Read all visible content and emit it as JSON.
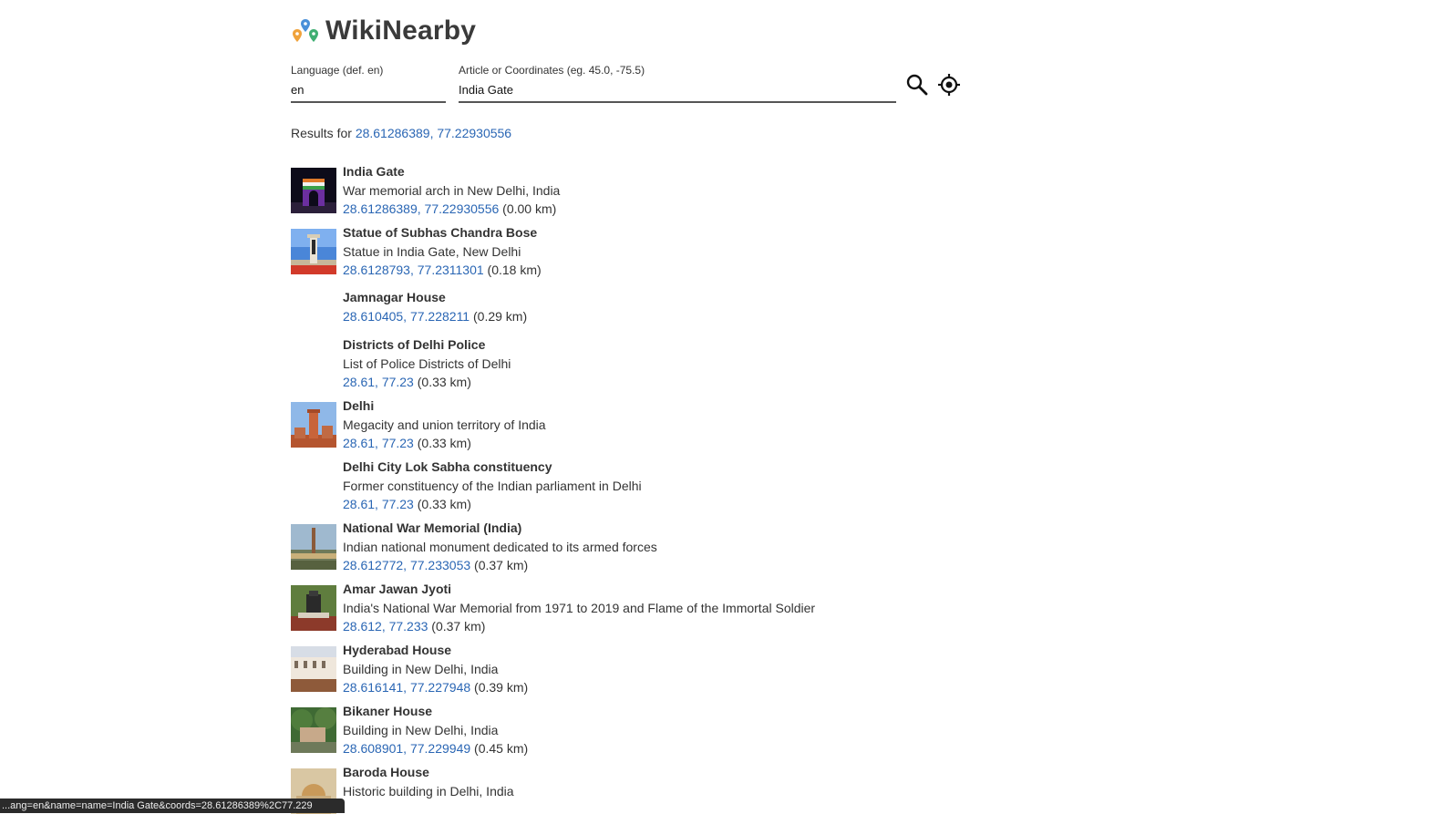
{
  "app": {
    "title": "WikiNearby"
  },
  "search": {
    "language_label": "Language (def. en)",
    "language_value": "en",
    "article_label": "Article or Coordinates (eg. 45.0, -75.5)",
    "article_value": "India Gate"
  },
  "results": {
    "prefix": "Results for ",
    "coords": "28.61286389, 77.22930556",
    "items": [
      {
        "title": "India Gate",
        "desc": "War memorial arch in New Delhi, India",
        "coords": "28.61286389, 77.22930556",
        "dist": " (0.00 km)"
      },
      {
        "title": "Statue of Subhas Chandra Bose",
        "desc": "Statue in India Gate, New Delhi",
        "coords": "28.6128793, 77.2311301",
        "dist": " (0.18 km)"
      },
      {
        "title": "Jamnagar House",
        "coords": "28.610405, 77.228211",
        "dist": " (0.29 km)"
      },
      {
        "title": "Districts of Delhi Police",
        "desc": "List of Police Districts of Delhi",
        "coords": "28.61, 77.23",
        "dist": " (0.33 km)"
      },
      {
        "title": "Delhi",
        "desc": "Megacity and union territory of India",
        "coords": "28.61, 77.23",
        "dist": " (0.33 km)"
      },
      {
        "title": "Delhi City Lok Sabha constituency",
        "desc": "Former constituency of the Indian parliament in Delhi",
        "coords": "28.61, 77.23",
        "dist": " (0.33 km)"
      },
      {
        "title": "National War Memorial (India)",
        "desc": "Indian national monument dedicated to its armed forces",
        "coords": "28.612772, 77.233053",
        "dist": " (0.37 km)"
      },
      {
        "title": "Amar Jawan Jyoti",
        "desc": "India's National War Memorial from 1971 to 2019 and Flame of the Immortal Soldier",
        "coords": "28.612, 77.233",
        "dist": " (0.37 km)"
      },
      {
        "title": "Hyderabad House",
        "desc": "Building in New Delhi, India",
        "coords": "28.616141, 77.227948",
        "dist": " (0.39 km)"
      },
      {
        "title": "Bikaner House",
        "desc": "Building in New Delhi, India",
        "coords": "28.608901, 77.229949",
        "dist": " (0.45 km)"
      },
      {
        "title": "Baroda House",
        "desc": "Historic building in Delhi, India"
      }
    ]
  },
  "statusbar": {
    "text": "...ang=en&name=name=India Gate&coords=28.61286389%2C77.229"
  },
  "colors": {
    "link": "#2a66b4",
    "text": "#333333",
    "underline": "#555555"
  }
}
